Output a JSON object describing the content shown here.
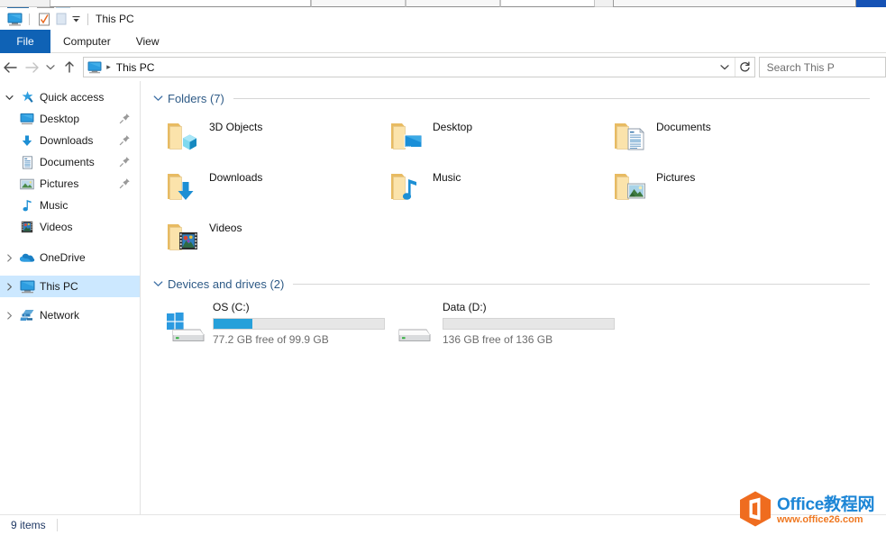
{
  "window": {
    "title": "This PC",
    "quick_access": [
      {
        "name": "this-pc-icon",
        "label": "This PC"
      },
      {
        "name": "properties-icon",
        "label": "Properties"
      },
      {
        "name": "new-folder-icon",
        "label": "New folder"
      },
      {
        "name": "customize-qat-caret",
        "label": "Customize Quick Access Toolbar"
      }
    ]
  },
  "ribbon": {
    "tabs": [
      {
        "label": "File",
        "active": true
      },
      {
        "label": "Computer",
        "active": false
      },
      {
        "label": "View",
        "active": false
      }
    ]
  },
  "navigation": {
    "back_label": "Back",
    "forward_label": "Forward",
    "recent_label": "Recent locations",
    "up_label": "Up",
    "address_text": "This PC",
    "address_icon": "this-pc-icon",
    "dropdown_label": "Previous locations",
    "refresh_label": "Refresh",
    "refresh_glyph": "↻",
    "search_placeholder": "Search This P"
  },
  "sidebar": {
    "items": [
      {
        "label": "Quick access",
        "icon": "star-pin-icon",
        "level": 0,
        "expanded": true,
        "chevron": "⌄",
        "selected": false,
        "pinned": false
      },
      {
        "label": "Desktop",
        "icon": "desktop-icon",
        "level": 1,
        "selected": false,
        "pinned": true
      },
      {
        "label": "Downloads",
        "icon": "downloads-icon",
        "level": 1,
        "selected": false,
        "pinned": true
      },
      {
        "label": "Documents",
        "icon": "documents-icon",
        "level": 1,
        "selected": false,
        "pinned": true
      },
      {
        "label": "Pictures",
        "icon": "pictures-icon",
        "level": 1,
        "selected": false,
        "pinned": true
      },
      {
        "label": "Music",
        "icon": "music-icon",
        "level": 1,
        "selected": false,
        "pinned": false
      },
      {
        "label": "Videos",
        "icon": "videos-icon",
        "level": 1,
        "selected": false,
        "pinned": false
      },
      {
        "label": "OneDrive",
        "icon": "onedrive-cloud-icon",
        "level": 0,
        "expanded": false,
        "chevron": "›",
        "selected": false,
        "pinned": false
      },
      {
        "label": "This PC",
        "icon": "this-pc-icon",
        "level": 0,
        "expanded": false,
        "chevron": "›",
        "selected": true,
        "pinned": false
      },
      {
        "label": "Network",
        "icon": "network-icon",
        "level": 0,
        "expanded": false,
        "chevron": "›",
        "selected": false,
        "pinned": false
      }
    ]
  },
  "main": {
    "groups": [
      {
        "id": "folders",
        "title": "Folders (7)",
        "chevron": "⌄",
        "expanded": true,
        "items": [
          {
            "label": "3D Objects",
            "icon": "folder-3d-objects-icon"
          },
          {
            "label": "Desktop",
            "icon": "folder-desktop-icon"
          },
          {
            "label": "Documents",
            "icon": "folder-documents-icon"
          },
          {
            "label": "Downloads",
            "icon": "folder-downloads-icon"
          },
          {
            "label": "Music",
            "icon": "folder-music-icon"
          },
          {
            "label": "Pictures",
            "icon": "folder-pictures-icon"
          },
          {
            "label": "Videos",
            "icon": "folder-videos-icon"
          }
        ]
      },
      {
        "id": "devices",
        "title": "Devices and drives (2)",
        "chevron": "⌄",
        "expanded": true,
        "drives": [
          {
            "name": "OS (C:)",
            "icon": "windows-drive-icon",
            "free_text": "77.2 GB free of 99.9 GB",
            "free_gb": 77.2,
            "total_gb": 99.9,
            "used_percent": 23
          },
          {
            "name": "Data (D:)",
            "icon": "drive-icon",
            "free_text": "136 GB free of 136 GB",
            "free_gb": 136,
            "total_gb": 136,
            "used_percent": 0
          }
        ]
      }
    ]
  },
  "statusbar": {
    "items_text": "9 items"
  },
  "watermark": {
    "title": "Office教程网",
    "url": "www.office26.com",
    "logo_color": "#ef7821",
    "title_color": "#1d86d6"
  },
  "colors": {
    "accent": "#0f62b5",
    "selection": "#cce8ff",
    "drive_bar": "#26a0da",
    "group_header": "#2e5a86",
    "folder_yellow": "#f6d488"
  }
}
